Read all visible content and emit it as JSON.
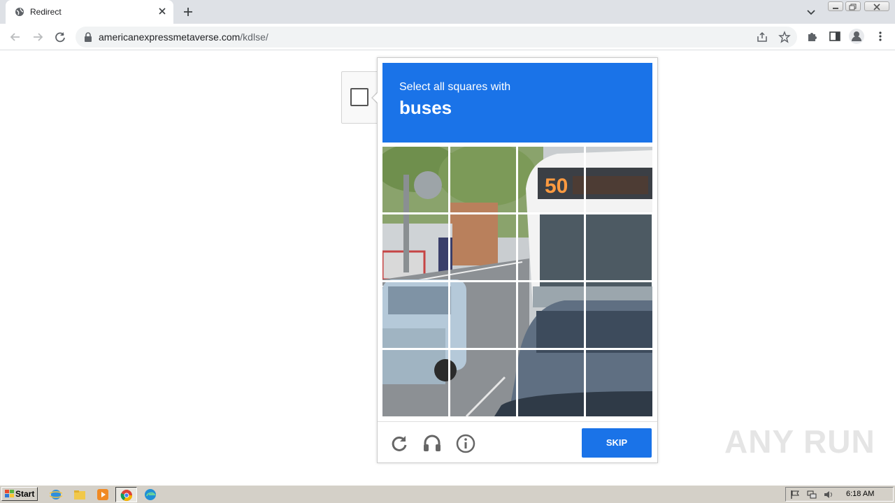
{
  "browser": {
    "tab": {
      "title": "Redirect"
    },
    "address": {
      "host": "americanexpressmetaverse.com",
      "path": "/kdlse/"
    }
  },
  "captcha": {
    "instruction": "Select all squares with",
    "target": "buses",
    "skip_label": "SKIP",
    "accent_color": "#1a73e8",
    "grid": {
      "rows": 4,
      "cols": 4
    },
    "bus_sign": "50"
  },
  "watermark": "ANY RUN",
  "taskbar": {
    "start_label": "Start",
    "clock": "6:18 AM"
  },
  "icons": [
    "globe-icon",
    "close-icon",
    "plus-icon",
    "chevron-down-icon",
    "back-arrow-icon",
    "forward-arrow-icon",
    "reload-icon",
    "lock-icon",
    "share-icon",
    "star-icon",
    "puzzle-icon",
    "sidepanel-icon",
    "profile-icon",
    "kebab-menu-icon",
    "refresh-icon",
    "headphones-icon",
    "info-icon",
    "ie-icon",
    "folder-icon",
    "media-player-icon",
    "chrome-icon",
    "edge-icon",
    "flag-icon",
    "network-icon",
    "speaker-icon"
  ]
}
